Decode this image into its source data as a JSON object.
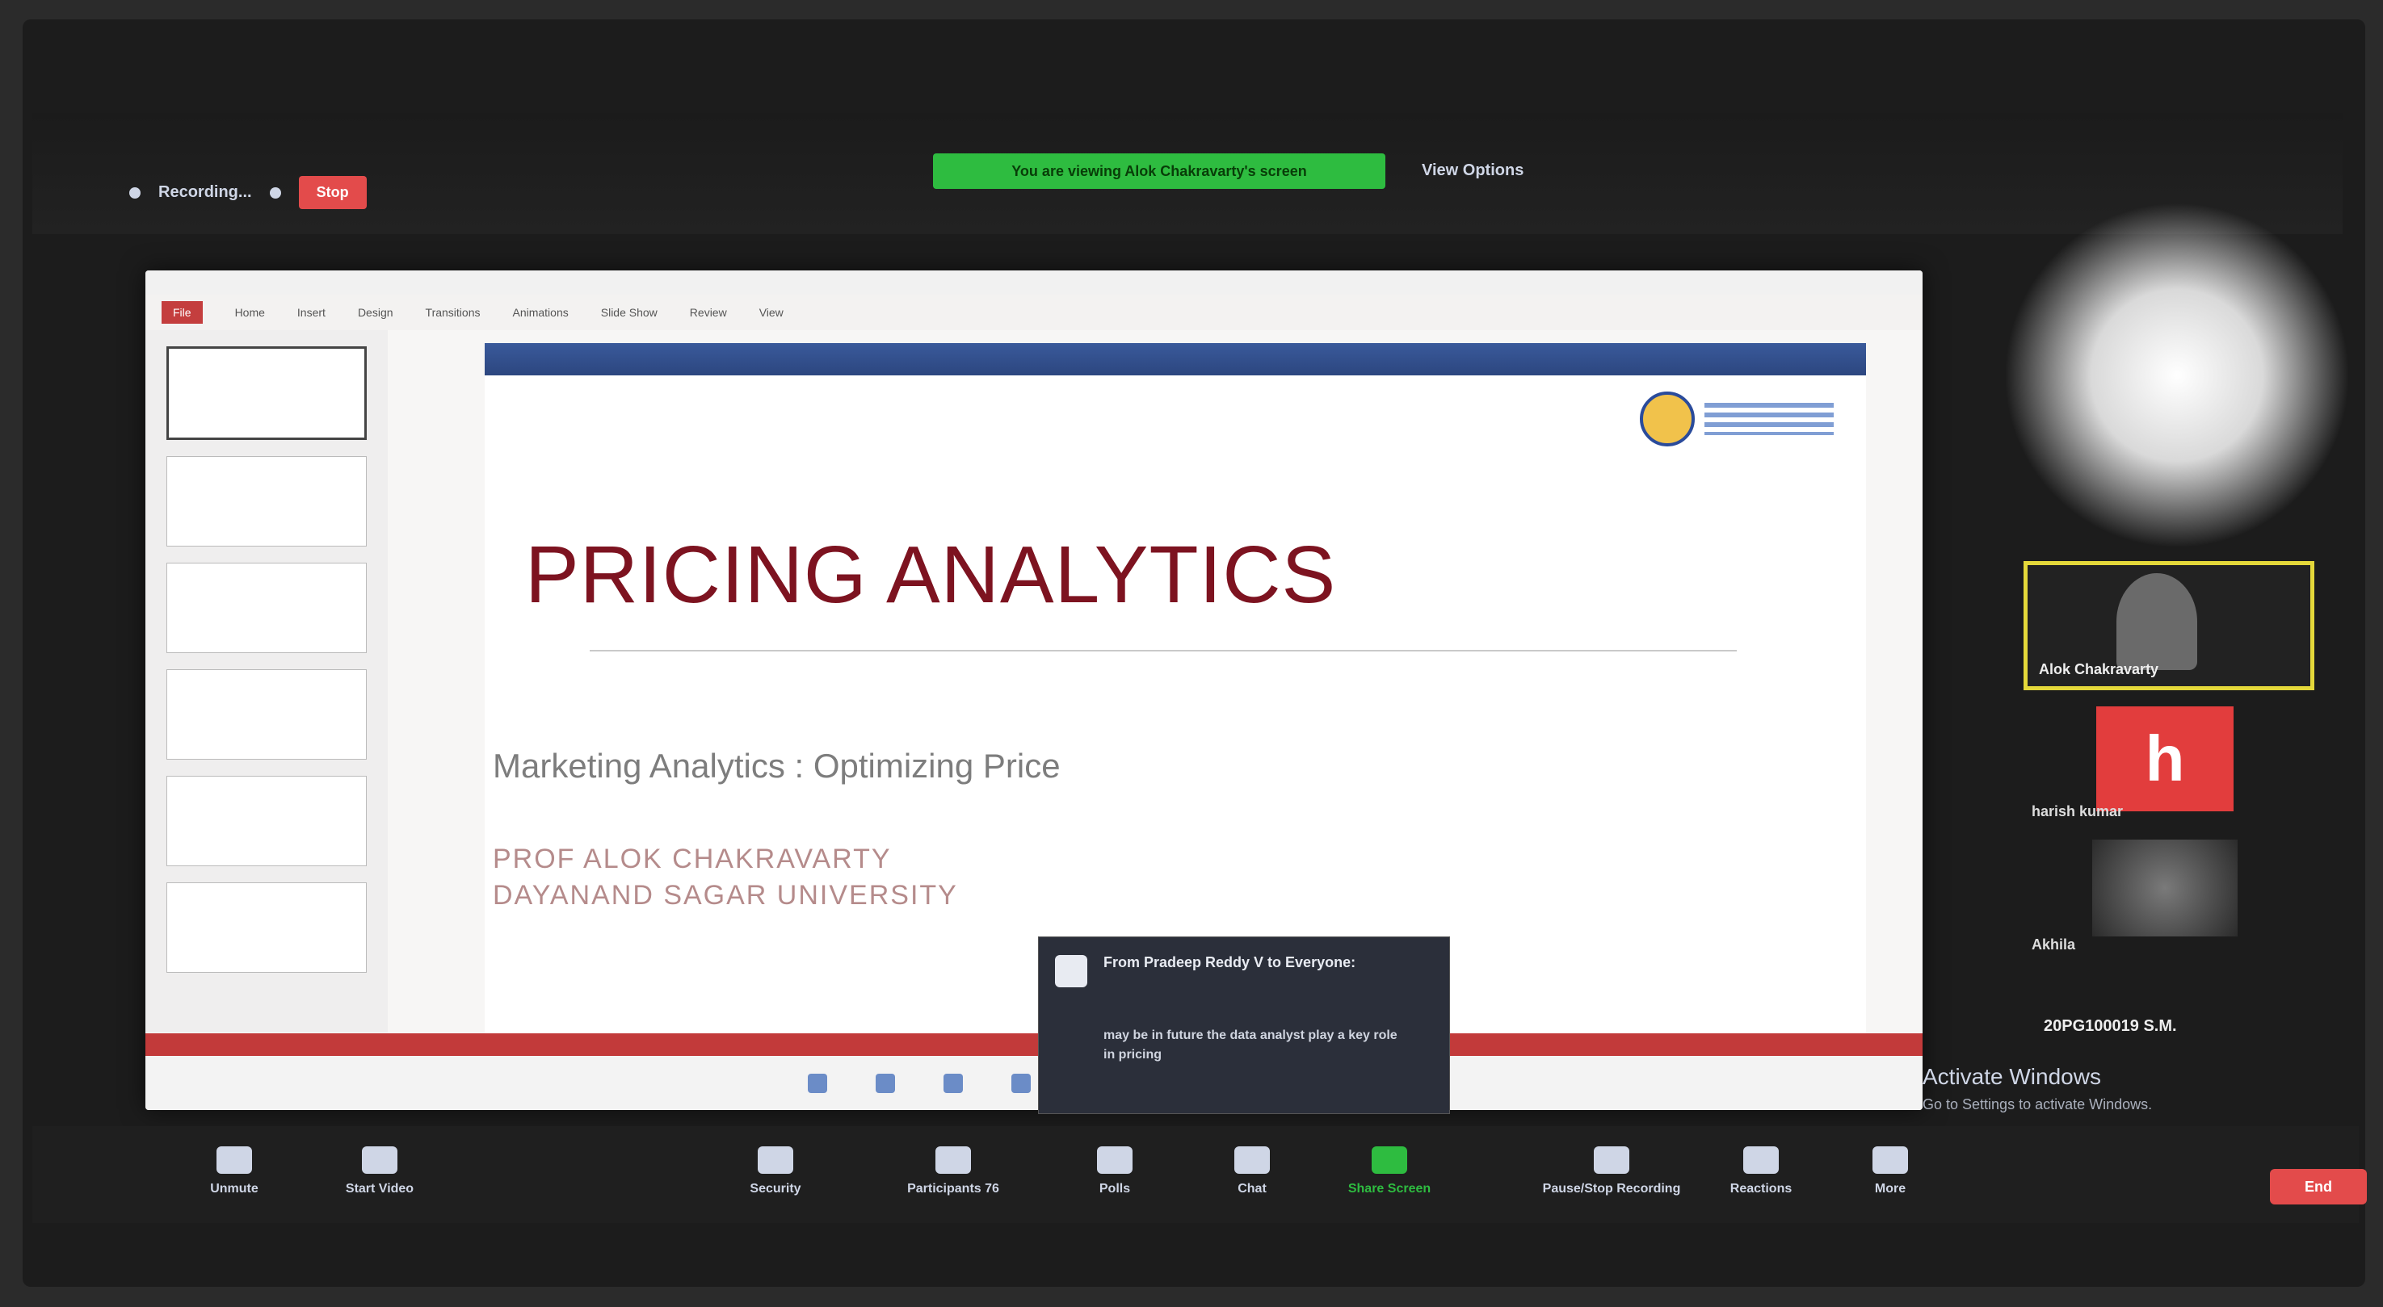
{
  "top_bar": {
    "recording_label": "Recording...",
    "stop_label": "Stop",
    "share_banner": "You are viewing Alok Chakravarty's screen",
    "view_options": "View Options"
  },
  "ppt": {
    "ribbon_tabs": [
      "File",
      "Home",
      "Insert",
      "Design",
      "Transitions",
      "Animations",
      "Slide Show",
      "Review",
      "View"
    ]
  },
  "slide": {
    "title": "PRICING ANALYTICS",
    "subtitle": "Marketing Analytics : Optimizing Price",
    "author": "PROF ALOK CHAKRAVARTY",
    "university": "DAYANAND SAGAR UNIVERSITY"
  },
  "chat_popup": {
    "from": "From Pradeep Reddy V to Everyone:",
    "message": "may be in future the data analyst play a key role in pricing"
  },
  "gallery": {
    "active_name": "Alok Chakravarty",
    "h_initial": "h",
    "h_name": "harish kumar",
    "pic_name": "Akhila",
    "id_label": "20PG100019 S.M.",
    "activate_title": "Activate Windows",
    "activate_sub": "Go to Settings to activate Windows."
  },
  "toolbar": {
    "unmute": "Unmute",
    "start_video": "Start Video",
    "security": "Security",
    "participants": "Participants",
    "participants_count": "76",
    "polls": "Polls",
    "chat": "Chat",
    "share_screen": "Share Screen",
    "recording": "Pause/Stop Recording",
    "reactions": "Reactions",
    "more": "More",
    "end": "End"
  }
}
